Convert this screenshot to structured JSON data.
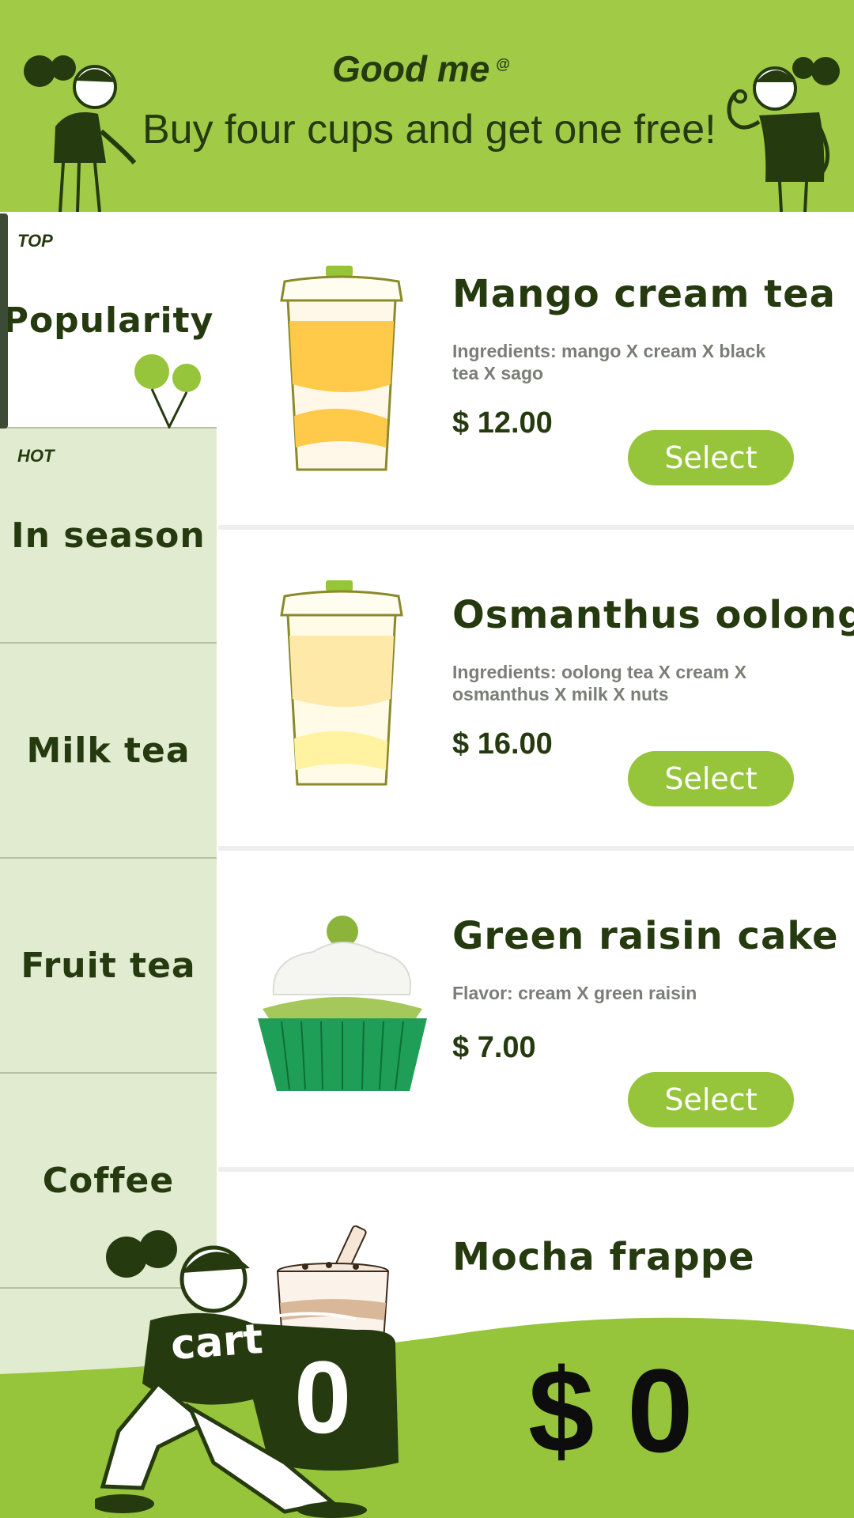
{
  "header": {
    "brand": "Good me",
    "brand_mark": "@",
    "promo": "Buy four cups and get one free!"
  },
  "sidebar": {
    "items": [
      {
        "tag": "TOP",
        "label": "Popularity",
        "active": true
      },
      {
        "tag": "HOT",
        "label": "In season",
        "active": false
      },
      {
        "tag": "",
        "label": "Milk tea",
        "active": false
      },
      {
        "tag": "",
        "label": "Fruit tea",
        "active": false
      },
      {
        "tag": "",
        "label": "Coffee",
        "active": false
      }
    ]
  },
  "products": [
    {
      "name": "Mango cream tea",
      "desc": "Ingredients: mango X cream X black tea X sago",
      "price": "$ 12.00",
      "button": "Select",
      "icon": "mango-cream-tea-cup-icon"
    },
    {
      "name": "Osmanthus oolong",
      "desc": "Ingredients: oolong tea X cream X osmanthus X milk X nuts",
      "price": "$ 16.00",
      "button": "Select",
      "icon": "osmanthus-oolong-cup-icon"
    },
    {
      "name": "Green raisin cake",
      "desc": "Flavor: cream X  green raisin",
      "price": "$ 7.00",
      "button": "Select",
      "icon": "cupcake-icon"
    },
    {
      "name": "Mocha frappe",
      "desc": "",
      "price": "",
      "button": "",
      "icon": "mocha-frappe-cup-icon"
    }
  ],
  "cart": {
    "label": "cart",
    "count": "0",
    "total": "$ 0"
  },
  "colors": {
    "brand_green": "#a1cb47",
    "button_green": "#96c43a",
    "dark_green": "#263a10",
    "sidebar_bg": "#e1ebcf"
  }
}
